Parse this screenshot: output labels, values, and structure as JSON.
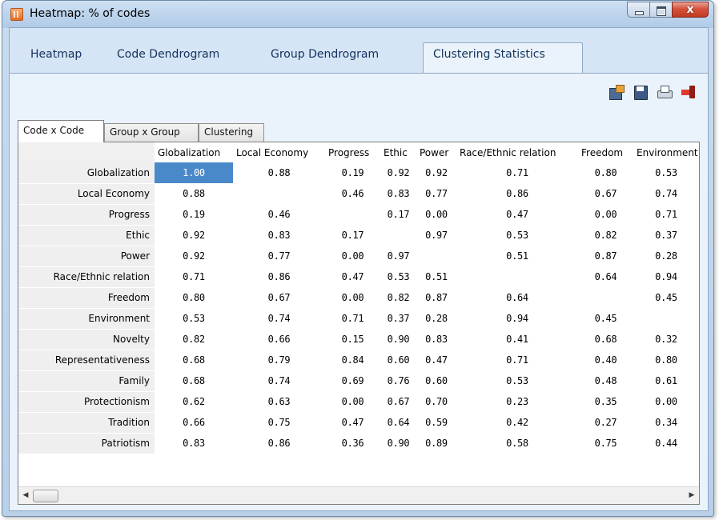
{
  "window": {
    "title": "Heatmap: % of codes",
    "close_glyph": "x"
  },
  "main_tabs": [
    {
      "label": "Heatmap"
    },
    {
      "label": "Code Dendrogram"
    },
    {
      "label": "Group Dendrogram"
    },
    {
      "label": "Clustering Statistics"
    }
  ],
  "active_main_tab": "Clustering Statistics",
  "toolbar": [
    "export-icon",
    "save-icon",
    "print-icon",
    "exit-icon"
  ],
  "sub_tabs": [
    {
      "label": "Code x Code"
    },
    {
      "label": "Group x Group"
    },
    {
      "label": "Clustering"
    }
  ],
  "active_sub_tab": "Code x Code",
  "table": {
    "columns": [
      "Globalization",
      "Local Economy",
      "Progress",
      "Ethic",
      "Power",
      "Race/Ethnic relation",
      "Freedom",
      "Environment"
    ],
    "rows": [
      {
        "label": "Globalization",
        "values": [
          "1.00",
          "0.88",
          "0.19",
          "0.92",
          "0.92",
          "0.71",
          "0.80",
          "0.53"
        ]
      },
      {
        "label": "Local Economy",
        "values": [
          "0.88",
          "",
          "0.46",
          "0.83",
          "0.77",
          "0.86",
          "0.67",
          "0.74"
        ]
      },
      {
        "label": "Progress",
        "values": [
          "0.19",
          "0.46",
          "",
          "0.17",
          "0.00",
          "0.47",
          "0.00",
          "0.71"
        ]
      },
      {
        "label": "Ethic",
        "values": [
          "0.92",
          "0.83",
          "0.17",
          "",
          "0.97",
          "0.53",
          "0.82",
          "0.37"
        ]
      },
      {
        "label": "Power",
        "values": [
          "0.92",
          "0.77",
          "0.00",
          "0.97",
          "",
          "0.51",
          "0.87",
          "0.28"
        ]
      },
      {
        "label": "Race/Ethnic relation",
        "values": [
          "0.71",
          "0.86",
          "0.47",
          "0.53",
          "0.51",
          "",
          "0.64",
          "0.94"
        ]
      },
      {
        "label": "Freedom",
        "values": [
          "0.80",
          "0.67",
          "0.00",
          "0.82",
          "0.87",
          "0.64",
          "",
          "0.45"
        ]
      },
      {
        "label": "Environment",
        "values": [
          "0.53",
          "0.74",
          "0.71",
          "0.37",
          "0.28",
          "0.94",
          "0.45",
          ""
        ]
      },
      {
        "label": "Novelty",
        "values": [
          "0.82",
          "0.66",
          "0.15",
          "0.90",
          "0.83",
          "0.41",
          "0.68",
          "0.32"
        ]
      },
      {
        "label": "Representativeness",
        "values": [
          "0.68",
          "0.79",
          "0.84",
          "0.60",
          "0.47",
          "0.71",
          "0.40",
          "0.80"
        ]
      },
      {
        "label": "Family",
        "values": [
          "0.68",
          "0.74",
          "0.69",
          "0.76",
          "0.60",
          "0.53",
          "0.48",
          "0.61"
        ]
      },
      {
        "label": "Protectionism",
        "values": [
          "0.62",
          "0.63",
          "0.00",
          "0.67",
          "0.70",
          "0.23",
          "0.35",
          "0.00"
        ]
      },
      {
        "label": "Tradition",
        "values": [
          "0.66",
          "0.75",
          "0.47",
          "0.64",
          "0.59",
          "0.42",
          "0.27",
          "0.34"
        ]
      },
      {
        "label": "Patriotism",
        "values": [
          "0.83",
          "0.86",
          "0.36",
          "0.90",
          "0.89",
          "0.58",
          "0.75",
          "0.44"
        ]
      }
    ]
  },
  "colors": {
    "selection": "#4a89c9",
    "row_header_bg": "#efefef",
    "tab_text": "#14325c"
  }
}
